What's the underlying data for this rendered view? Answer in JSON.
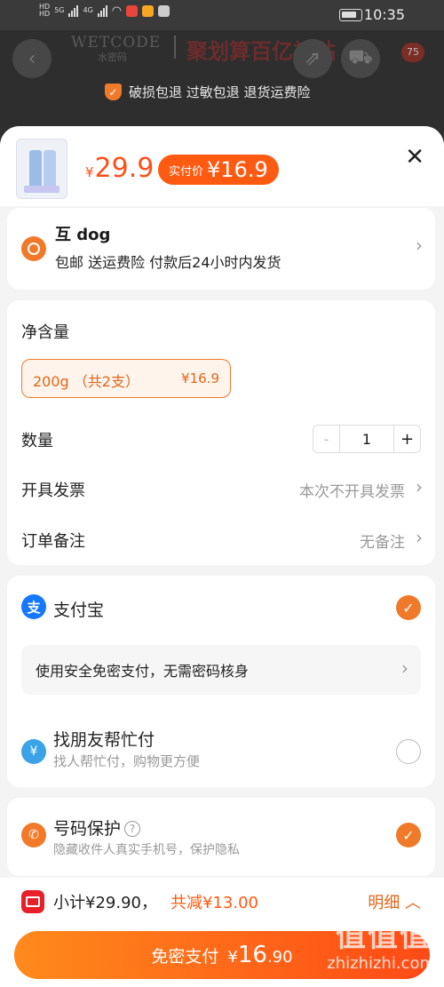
{
  "status_bar": {
    "time": "10:35",
    "hd1": "HD",
    "hd2": "HD",
    "net1": "5G",
    "net2": "4G"
  },
  "header": {
    "brand": "WETCODE",
    "brand_sub": "水密码",
    "promo": "聚划算百亿补贴",
    "cart_count": "75",
    "guarantee": "破损包退 过敏包退 退货运费险"
  },
  "product": {
    "price_currency": "¥",
    "price": "29.9",
    "actual_label": "实付价",
    "actual_price": "¥16.9"
  },
  "address": {
    "name": "互 dog",
    "desc": "包邮  送运费险  付款后24小时内发货"
  },
  "options": {
    "spec_title": "净含量",
    "spec_name": "200g （共2支）",
    "spec_price": "¥16.9",
    "qty_label": "数量",
    "qty_minus": "-",
    "qty_value": "1",
    "qty_plus": "+",
    "invoice_label": "开具发票",
    "invoice_value": "本次不开具发票",
    "note_label": "订单备注",
    "note_value": "无备注"
  },
  "payment": {
    "alipay_label": "支付宝",
    "alipay_icon_text": "支",
    "nopwd_text": "使用安全免密支付，无需密码核身",
    "friend_label": "找朋友帮忙付",
    "friend_sub": "找人帮忙付，购物更方便",
    "friend_icon_text": "¥"
  },
  "privacy": {
    "label": "号码保护",
    "sub": "隐藏收件人真实手机号，保护隐私"
  },
  "footer": {
    "subtotal": "小计¥29.90，",
    "discount": "共减¥13.00",
    "detail": "明细",
    "pay_label": "免密支付",
    "pay_currency": "¥",
    "pay_amount_int": "16",
    "pay_amount_dec": ".90"
  },
  "watermark": {
    "text": "值值值",
    "site": "zhizhizhi.com"
  },
  "colors": {
    "accent": "#f07a2a",
    "price": "#ff4f1a",
    "alipay": "#1677ff"
  }
}
